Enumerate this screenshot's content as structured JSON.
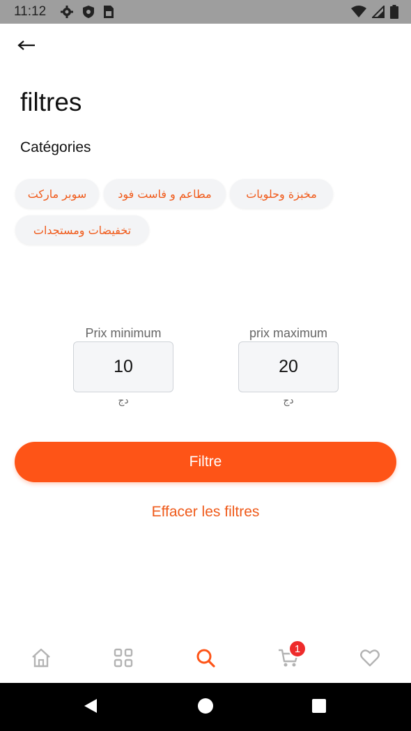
{
  "status_bar": {
    "time": "11:12",
    "left_icons": [
      "gear-icon",
      "shield-icon",
      "sim-card-icon"
    ],
    "right_icons": [
      "wifi-icon",
      "signal-icon",
      "battery-icon"
    ]
  },
  "header": {
    "back_icon": "arrow-left-icon"
  },
  "title": "filtres",
  "categories": {
    "label": "Catégories",
    "items": [
      "مخبزة وحلويات",
      "مطاعم و فاست فود",
      "سوبر ماركت",
      "تخفيضات ومستجدات"
    ]
  },
  "price": {
    "min": {
      "label": "Prix minimum",
      "value": "10",
      "unit": "دج"
    },
    "max": {
      "label": "prix maximum",
      "value": "20",
      "unit": "دج"
    }
  },
  "actions": {
    "filter_label": "Filtre",
    "clear_label": "Effacer les filtres"
  },
  "bottom_nav": {
    "items": [
      "home-icon",
      "grid-icon",
      "search-icon",
      "cart-icon",
      "heart-icon"
    ],
    "active": "search-icon",
    "cart_badge": "1"
  },
  "colors": {
    "accent": "#fe5417",
    "chip_text": "#f05a1a",
    "chip_bg": "#f3f4f6",
    "badge": "#ee2b2b",
    "inactive_icon": "#b3b3b3"
  }
}
